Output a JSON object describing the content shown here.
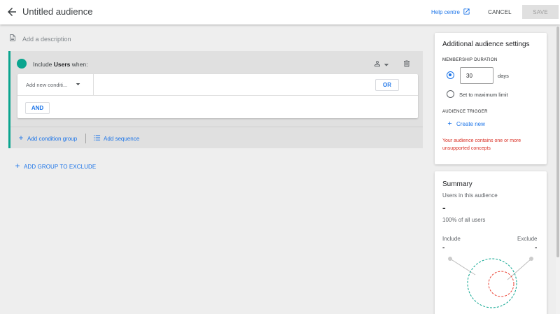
{
  "header": {
    "title": "Untitled audience",
    "help_label": "Help centre",
    "cancel_label": "CANCEL",
    "save_label": "SAVE"
  },
  "description": {
    "placeholder": "Add a description"
  },
  "include_group": {
    "prefix": "Include ",
    "scope": "Users",
    "suffix": " when:",
    "condition_placeholder": "Add new conditi...",
    "or_label": "OR",
    "and_label": "AND",
    "add_condition_group_label": "Add condition group",
    "add_sequence_label": "Add sequence"
  },
  "exclude": {
    "label": "ADD GROUP TO EXCLUDE"
  },
  "settings": {
    "title": "Additional audience settings",
    "membership_label": "MEMBERSHIP DURATION",
    "duration_value": "30",
    "duration_unit": "days",
    "max_limit_label": "Set to maximum limit",
    "trigger_label": "AUDIENCE TRIGGER",
    "create_new_label": "Create new",
    "warning": "Your audience contains one or more unsupported concepts"
  },
  "summary": {
    "title": "Summary",
    "users_label": "Users in this audience",
    "users_value": "-",
    "percent_label": "100% of all users",
    "include_label": "Include",
    "exclude_label": "Exclude",
    "include_value": "-",
    "exclude_value": "-"
  },
  "colors": {
    "accent": "#1a73e8",
    "include_green": "#0ba58f",
    "warning_red": "#d93025"
  }
}
